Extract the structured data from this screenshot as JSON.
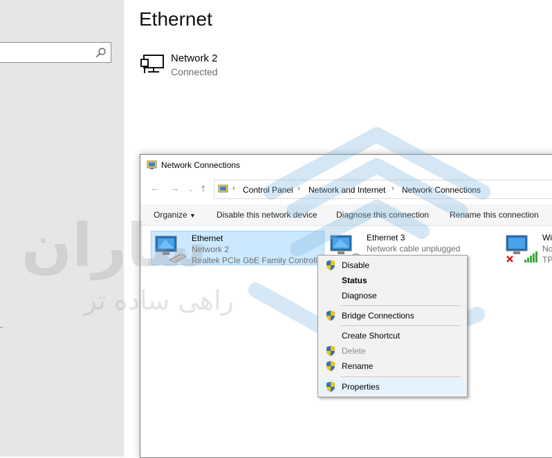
{
  "settings": {
    "page_title": "Ethernet",
    "network": {
      "name": "Network 2",
      "status": "Connected"
    },
    "left_dash": "-"
  },
  "window": {
    "title": "Network Connections",
    "breadcrumbs": [
      "Control Panel",
      "Network and Internet",
      "Network Connections"
    ],
    "commands": {
      "organize": "Organize",
      "disable": "Disable this network device",
      "diagnose": "Diagnose this connection",
      "rename": "Rename this connection"
    },
    "adapters": [
      {
        "name": "Ethernet",
        "network": "Network 2",
        "device": "Realtek PCIe GbE Family Controller"
      },
      {
        "name": "Ethernet 3",
        "network": "Network cable unplugged",
        "device": ""
      },
      {
        "name": "Wi",
        "network": "No",
        "device": "TP-"
      }
    ]
  },
  "context_menu": {
    "items": [
      {
        "label": "Disable",
        "shield": true
      },
      {
        "label": "Status",
        "bold": true
      },
      {
        "label": "Diagnose"
      },
      {
        "label": "Bridge Connections",
        "shield": true
      },
      {
        "label": "Create Shortcut"
      },
      {
        "label": "Delete",
        "shield": true,
        "disabled": true
      },
      {
        "label": "Rename",
        "shield": true
      },
      {
        "label": "Properties",
        "shield": true
      }
    ]
  },
  "watermark": {
    "line1": "ساران",
    "line2": "راهی ساده تر"
  },
  "colors": {
    "selection": "#cce8ff",
    "selection_border": "#99d1ff",
    "menu_bg": "#f2f2f2",
    "left_pane": "#e6e6e6",
    "watermark": "#7fb7df"
  }
}
